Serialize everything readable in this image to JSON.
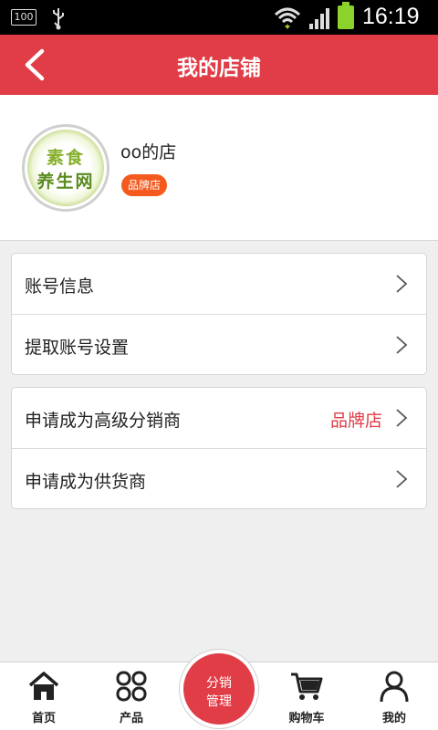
{
  "status_bar": {
    "battery_percent": "100",
    "time": "16:19"
  },
  "header": {
    "title": "我的店铺"
  },
  "shop": {
    "name": "oo的店",
    "badge": "品牌店",
    "logo_line1": "素食",
    "logo_line2": "养生网"
  },
  "menu_groups": [
    {
      "items": [
        {
          "label": "账号信息"
        },
        {
          "label": "提取账号设置"
        }
      ]
    },
    {
      "items": [
        {
          "label": "申请成为高级分销商",
          "value": "品牌店"
        },
        {
          "label": "申请成为供货商"
        }
      ]
    }
  ],
  "bottom_nav": {
    "items": [
      {
        "label": "首页",
        "icon": "home-icon"
      },
      {
        "label": "产品",
        "icon": "grid-icon"
      },
      {
        "label": "购物车",
        "icon": "cart-icon"
      },
      {
        "label": "我的",
        "icon": "user-icon"
      }
    ],
    "center": {
      "line1": "分销",
      "line2": "管理"
    }
  },
  "colors": {
    "accent": "#e03d47",
    "badge": "#f45a1e",
    "background": "#efefef"
  }
}
